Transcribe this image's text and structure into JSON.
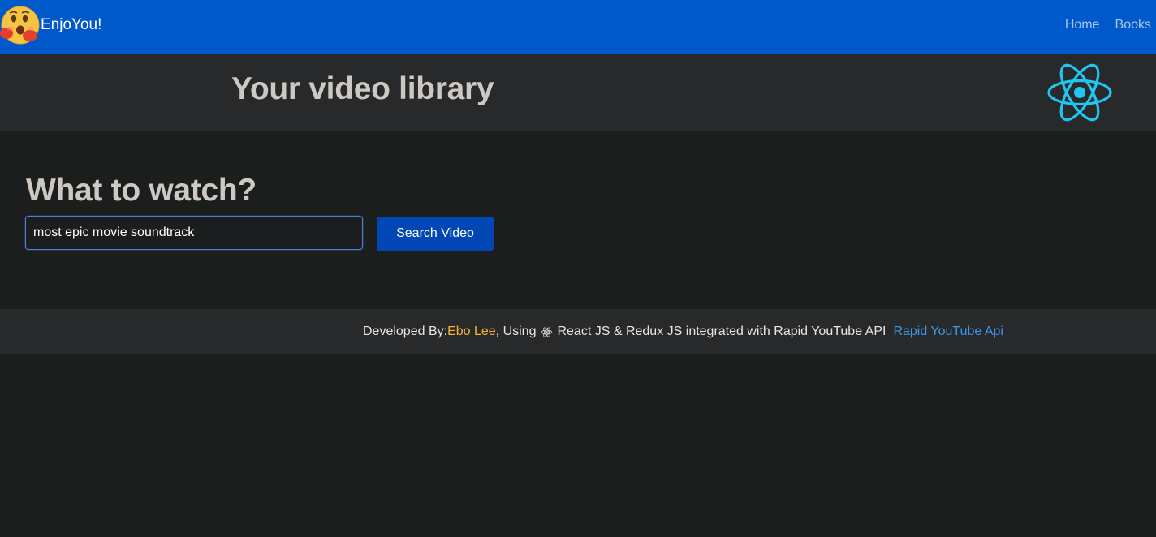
{
  "navbar": {
    "brand_name": "EnjoYou!",
    "brand_icon": "hugging-face-emoji-icon",
    "links": [
      {
        "label": "Home"
      },
      {
        "label": "Books"
      }
    ]
  },
  "hero": {
    "title": "Your video library",
    "logo_icon": "react-logo-icon"
  },
  "search": {
    "heading": "What to watch?",
    "query_value": "most epic movie soundtrack",
    "button_label": "Search Video"
  },
  "footer": {
    "prefix": "Developed By:",
    "author": "Ebo Lee",
    "using_text": ", Using",
    "tech_text": "React JS & Redux JS integrated with Rapid YouTube API",
    "link_label": "Rapid YouTube Api"
  },
  "colors": {
    "navbar_bg": "#0059cb",
    "hero_bg": "#28292b",
    "page_bg": "#1c1d1d",
    "react_accent": "#1fc6f0",
    "author_accent": "#f6b531",
    "link_accent": "#3d97ec",
    "button_bg": "#0046b4"
  }
}
